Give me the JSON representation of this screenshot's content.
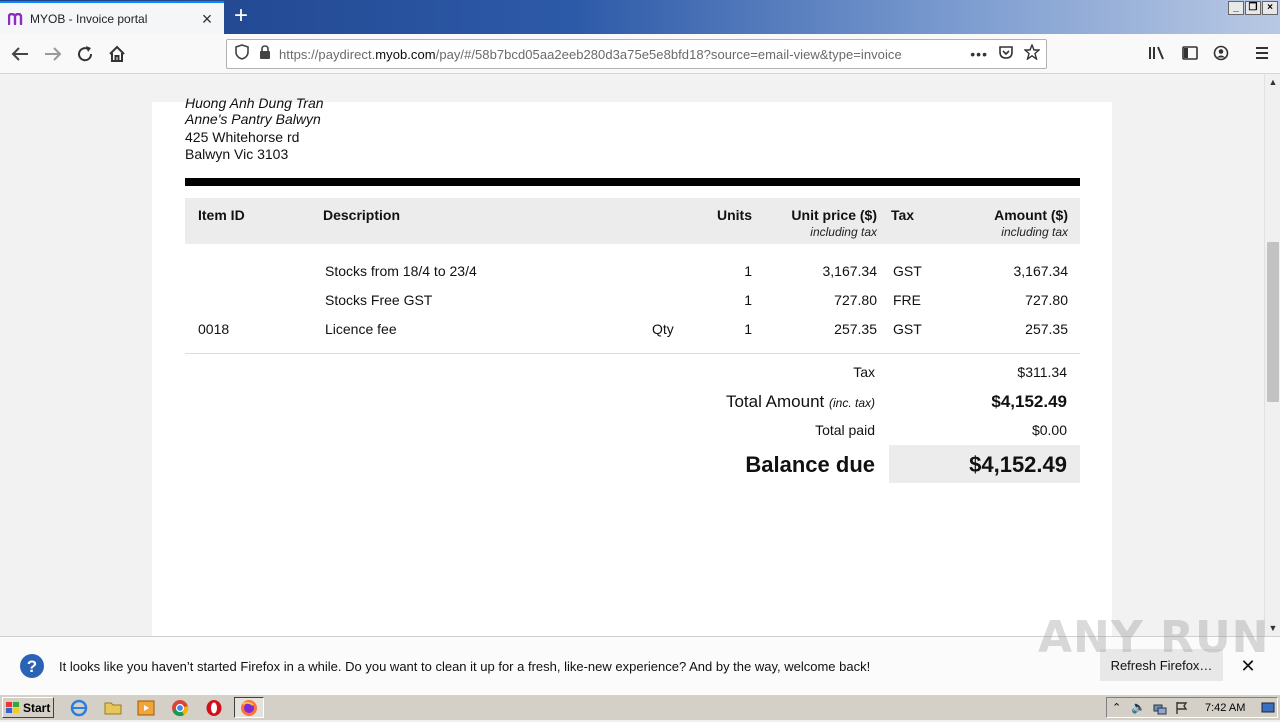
{
  "browser": {
    "tab_title": "MYOB - Invoice portal",
    "url_prefix": "https://paydirect.",
    "url_domain": "myob.com",
    "url_suffix": "/pay/#/58b7bcd05aa2eeb280d3a75e5e8bfd18?source=email-view&type=invoice"
  },
  "invoice": {
    "bill_to": {
      "name": "Huong Anh Dung Tran",
      "business": "Anne's Pantry Balwyn",
      "street": "425 Whitehorse rd",
      "suburb": "Balwyn Vic 3103"
    },
    "columns": {
      "item_id": "Item ID",
      "description": "Description",
      "units": "Units",
      "unit_price": "Unit price ($)",
      "unit_price_note": "including tax",
      "tax": "Tax",
      "amount": "Amount ($)",
      "amount_note": "including tax"
    },
    "lines": [
      {
        "item_id": "",
        "description": "Stocks from 18/4 to 23/4",
        "uom": "",
        "units": "1",
        "unit_price": "3,167.34",
        "tax": "GST",
        "amount": "3,167.34"
      },
      {
        "item_id": "",
        "description": "Stocks Free GST",
        "uom": "",
        "units": "1",
        "unit_price": "727.80",
        "tax": "FRE",
        "amount": "727.80"
      },
      {
        "item_id": "0018",
        "description": "Licence fee",
        "uom": "Qty",
        "units": "1",
        "unit_price": "257.35",
        "tax": "GST",
        "amount": "257.35"
      }
    ],
    "summary": {
      "tax_label": "Tax",
      "tax_value": "$311.34",
      "total_label": "Total Amount",
      "total_note": "(inc. tax)",
      "total_value": "$4,152.49",
      "paid_label": "Total paid",
      "paid_value": "$0.00",
      "balance_label": "Balance due",
      "balance_value": "$4,152.49"
    }
  },
  "notification": {
    "message": "It looks like you haven’t started Firefox in a while. Do you want to clean it up for a fresh, like-new experience? And by the way, welcome back!",
    "button": "Refresh Firefox…",
    "close": "✕"
  },
  "watermark": "ANY RUN",
  "taskbar": {
    "start_label": "Start",
    "clock": "7:42 AM"
  }
}
